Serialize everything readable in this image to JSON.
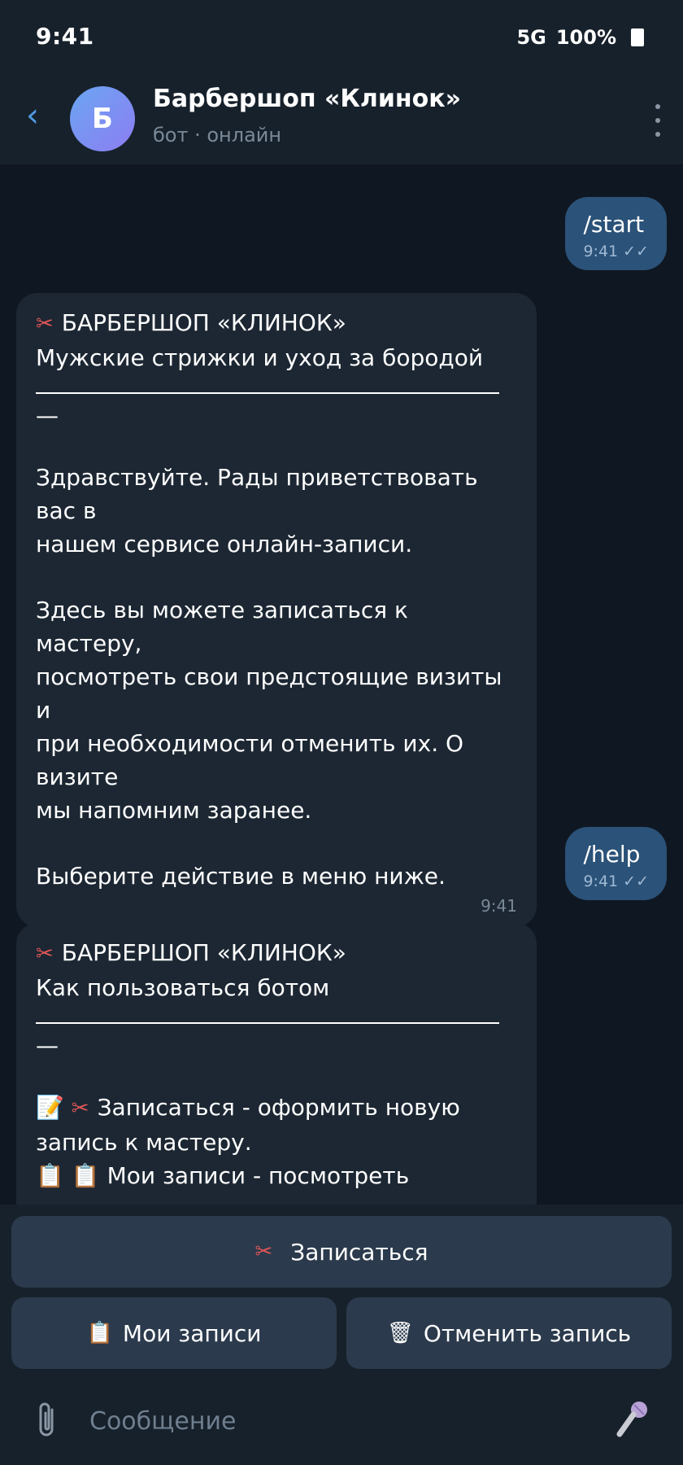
{
  "status": {
    "time": "9:41",
    "network": "5G",
    "battery": "100%"
  },
  "header": {
    "avatar_letter": "Б",
    "title": "Барбершоп «Клинок»",
    "subtitle": "бот · онлайн"
  },
  "messages": [
    {
      "type": "out",
      "text": "/start",
      "time": "9:41 ✓✓"
    },
    {
      "type": "in",
      "heading": "БАРБЕРШОП «КЛИНОК»",
      "subheading": "Мужские стрижки и уход за бородой",
      "dash": "—",
      "paragraphs": [
        "Здравствуйте. Рады приветствовать вас в\nнашем сервисе онлайн-записи.",
        "Здесь вы можете записаться к мастеру,\nпосмотреть свои предстоящие визиты и\nпри необходимости отменить их. О визите\nмы напомним заранее.",
        "Выберите действие в меню ниже."
      ],
      "time": "9:41"
    },
    {
      "type": "out",
      "text": "/help",
      "time": "9:41 ✓✓"
    },
    {
      "type": "in",
      "heading": "БАРБЕРШОП «КЛИНОК»",
      "subheading": "Как пользоваться ботом",
      "dash": "—",
      "items": [
        "Записаться - оформить новую\nзапись к мастеру.",
        "Мои записи - посмотреть"
      ]
    }
  ],
  "keyboard": {
    "book": "Записаться",
    "my_bookings": "Мои записи",
    "cancel": "Отменить запись"
  },
  "input": {
    "placeholder": "Сообщение"
  },
  "icons": {
    "back": "chevron-left-icon",
    "menu": "kebab-icon",
    "scissors": "scissors-icon",
    "memo": "memo-icon",
    "clipboard": "clipboard-icon",
    "trash": "trash-icon",
    "attach": "paperclip-icon",
    "mic": "microphone-icon"
  },
  "colors": {
    "accent": "#4f9be0",
    "outgoing_bubble": "#2b5278",
    "incoming_bubble": "#1c2733",
    "button": "#2b3a4c"
  }
}
